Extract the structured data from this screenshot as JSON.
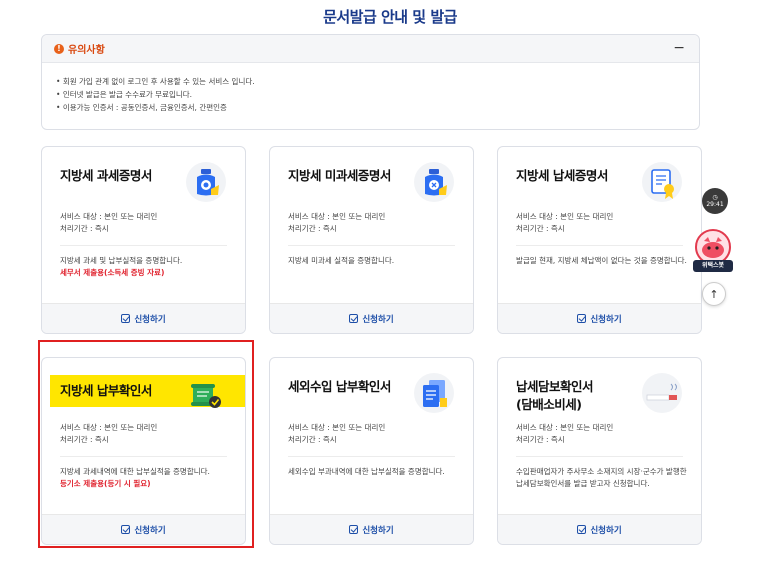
{
  "page": {
    "title": "문서발급 안내 및 발급"
  },
  "notice": {
    "title": "유의사항",
    "collapse": "−",
    "warn": "!",
    "items": [
      "회원 가입 관계 없이 로그인 후 사용할 수 있는 서비스 입니다.",
      "인터넷 발급은 발급 수수료가 무료입니다.",
      "이용가능 인증서 : 공동인증서, 금융인증서, 간편인증"
    ]
  },
  "cards": [
    {
      "title": "지방세 과세증명서",
      "target": "서비스 대상 : 본인 또는 대리인",
      "period": "처리기간 : 즉시",
      "desc": "지방세 과세 및 납부실적을 증명합니다.",
      "note": "세무서 제출용(소득세 증빙 자료)",
      "apply": "신청하기",
      "icon": "bottle-icon"
    },
    {
      "title": "지방세 미과세증명서",
      "target": "서비스 대상 : 본인 또는 대리인",
      "period": "처리기간 : 즉시",
      "desc": "지방세 미과세 실적을 증명합니다.",
      "apply": "신청하기",
      "icon": "bottle-icon"
    },
    {
      "title": "지방세 납세증명서",
      "target": "서비스 대상 : 본인 또는 대리인",
      "period": "처리기간 : 즉시",
      "desc": "발급일 현재, 지방세 체납액이 없다는 것을 증명합니다.",
      "apply": "신청하기",
      "icon": "certificate-icon"
    },
    {
      "title": "지방세 납부확인서",
      "target": "서비스 대상 : 본인 또는 대리인",
      "period": "처리기간 : 즉시",
      "desc": "지방세 과세내역에 대한 납부실적을 증명합니다.",
      "note": "등기소 제출용(등기 시 필요)",
      "apply": "신청하기",
      "icon": "scroll-check-icon"
    },
    {
      "title": "세외수입 납부확인서",
      "target": "서비스 대상 : 본인 또는 대리인",
      "period": "처리기간 : 즉시",
      "desc": "세외수입 부과내역에 대한 납부실적을 증명합니다.",
      "apply": "신청하기",
      "icon": "document-stack-icon"
    },
    {
      "title": "납세담보확인서\n(담배소비세)",
      "target": "서비스 대상 : 본인 또는 대리인",
      "period": "처리기간 : 즉시",
      "desc": "수입판매업자가 주사무소 소재지의 시장·군수가 발행한 납세담보확인서를 발급 받고자 신청합니다.",
      "apply": "신청하기",
      "icon": "cigarette-icon"
    }
  ],
  "side": {
    "timer_value": "29:41",
    "mascot_label": "위택스봇",
    "top": "↑"
  },
  "colors": {
    "title": "#1a3a8a",
    "accent": "#1e4fa8",
    "highlight": "#ffe600",
    "alert": "#e0222e"
  }
}
